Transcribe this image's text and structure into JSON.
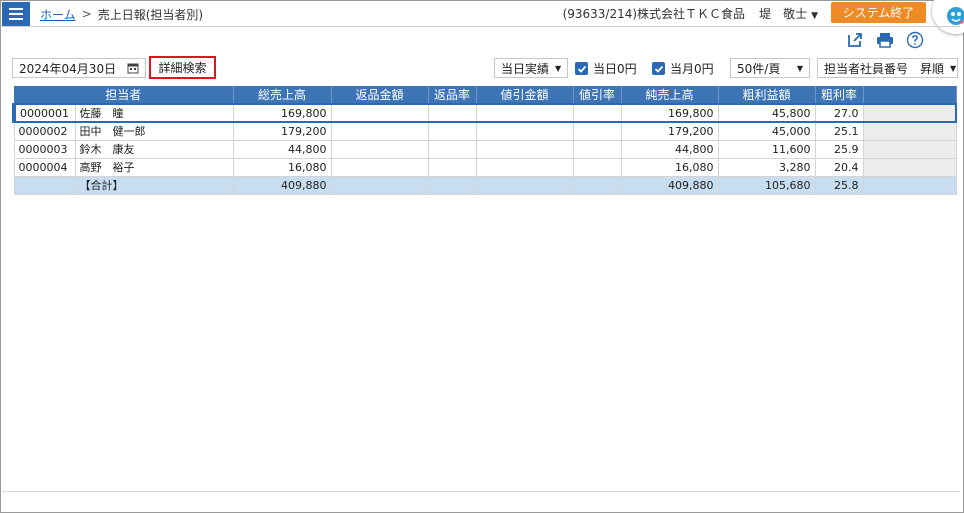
{
  "header": {
    "breadcrumb_home": "ホーム",
    "breadcrumb_sep": ">",
    "page_title": "売上日報(担当者別)",
    "company": "(93633/214)株式会社ＴＫＣ食品",
    "user": "堤　敬士",
    "exit_label": "システム終了"
  },
  "icons": {
    "menu": "menu-icon",
    "export": "export-icon",
    "print": "print-icon",
    "help": "help-icon",
    "calendar": "calendar-icon",
    "avatar": "mascot-avatar"
  },
  "filters": {
    "date": "2024年04月30日",
    "detail_search": "詳細検索",
    "mode": "当日実績",
    "today_zero": "当日0円",
    "today_zero_checked": true,
    "month_zero": "当月0円",
    "month_zero_checked": true,
    "page_size": "50件/頁",
    "sort": "担当者社員番号　昇順"
  },
  "table": {
    "headers": [
      "担当者",
      "総売上高",
      "返品金額",
      "返品率",
      "値引金額",
      "値引率",
      "純売上高",
      "粗利益額",
      "粗利率"
    ],
    "rows": [
      {
        "code": "0000001",
        "name": "佐藤　瞳",
        "gross": "169,800",
        "ret_amt": "",
        "ret_rate": "",
        "disc_amt": "",
        "disc_rate": "",
        "net": "169,800",
        "profit": "45,800",
        "margin": "27.0"
      },
      {
        "code": "0000002",
        "name": "田中　健一郎",
        "gross": "179,200",
        "ret_amt": "",
        "ret_rate": "",
        "disc_amt": "",
        "disc_rate": "",
        "net": "179,200",
        "profit": "45,000",
        "margin": "25.1"
      },
      {
        "code": "0000003",
        "name": "鈴木　康友",
        "gross": "44,800",
        "ret_amt": "",
        "ret_rate": "",
        "disc_amt": "",
        "disc_rate": "",
        "net": "44,800",
        "profit": "11,600",
        "margin": "25.9"
      },
      {
        "code": "0000004",
        "name": "高野　裕子",
        "gross": "16,080",
        "ret_amt": "",
        "ret_rate": "",
        "disc_amt": "",
        "disc_rate": "",
        "net": "16,080",
        "profit": "3,280",
        "margin": "20.4"
      }
    ],
    "total": {
      "code": "",
      "name": "【合計】",
      "gross": "409,880",
      "ret_amt": "",
      "ret_rate": "",
      "disc_amt": "",
      "disc_rate": "",
      "net": "409,880",
      "profit": "105,680",
      "margin": "25.8"
    }
  },
  "colors": {
    "accent": "#2a6ab4",
    "header_bg": "#3d74b6",
    "exit_button": "#f08a24",
    "highlight_border": "#e0141e",
    "total_row": "#c9ddf1"
  }
}
